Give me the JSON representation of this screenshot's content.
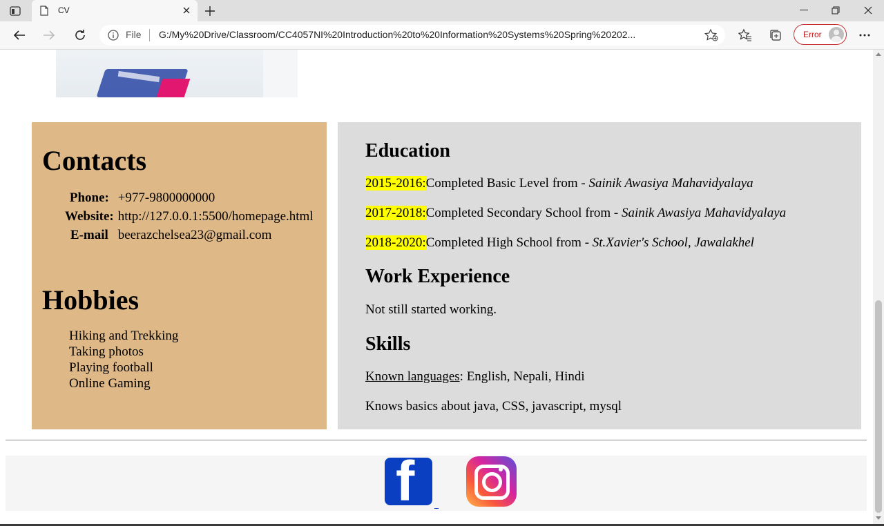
{
  "browser": {
    "tab_title": "CV",
    "url_scheme_label": "File",
    "url": "G:/My%20Drive/Classroom/CC4057NI%20Introduction%20to%20Information%20Systems%20Spring%20202...",
    "profile_status": "Error"
  },
  "contacts": {
    "title": "Contacts",
    "rows": [
      {
        "label": "Phone:",
        "value": "+977-9800000000"
      },
      {
        "label": "Website:",
        "value": "http://127.0.0.1:5500/homepage.html"
      },
      {
        "label": "E-mail",
        "value": "beerazchelsea23@gmail.com"
      }
    ]
  },
  "hobbies": {
    "title": "Hobbies",
    "items": [
      "Hiking and Trekking",
      "Taking photos",
      "Playing football",
      "Online Gaming"
    ]
  },
  "education": {
    "title": "Education",
    "entries": [
      {
        "years": "2015-2016:",
        "text": "Completed Basic Level from - ",
        "school": "Sainik Awasiya Mahavidyalaya"
      },
      {
        "years": "2017-2018:",
        "text": "Completed Secondary School from - ",
        "school": "Sainik Awasiya Mahavidyalaya"
      },
      {
        "years": "2018-2020:",
        "text": "Completed High School from - ",
        "school": "St.Xavier's School, Jawalakhel"
      }
    ]
  },
  "work": {
    "title": "Work Experience",
    "text": "Not still started working."
  },
  "skills": {
    "title": "Skills",
    "languages_label": "Known languages",
    "languages_value": ": English, Nepali, Hindi",
    "tech": "Knows basics about java, CSS, javascript, mysql"
  },
  "footer": {
    "icons": [
      "facebook-icon",
      "instagram-icon"
    ]
  },
  "colors": {
    "left_panel": "#deb887",
    "right_panel": "#dcdcdc",
    "highlight": "#ffff00",
    "error_red": "#c53030"
  }
}
